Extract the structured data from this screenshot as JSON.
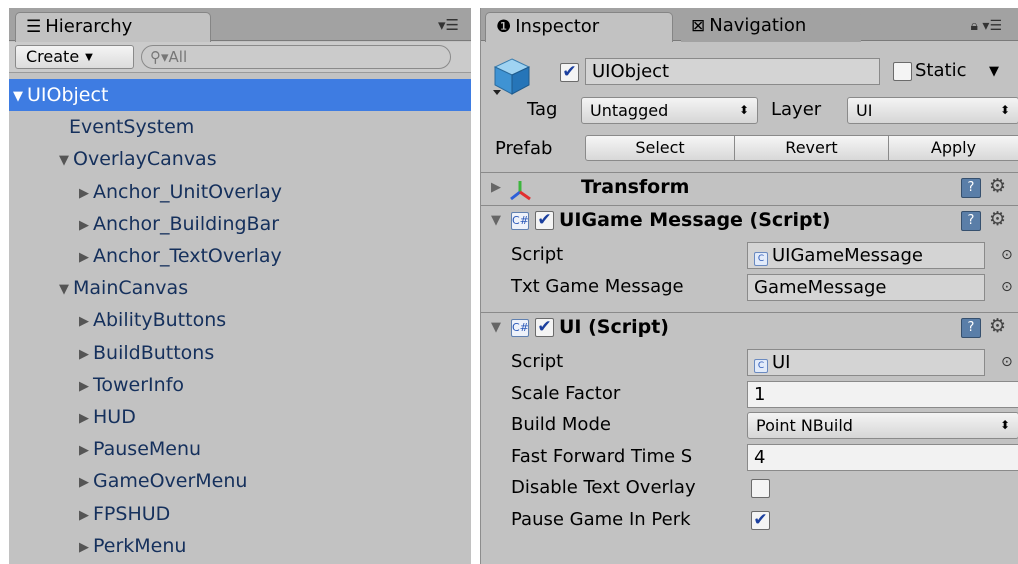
{
  "hierarchy": {
    "tab_label": "Hierarchy",
    "create_label": "Create",
    "search_placeholder": "All",
    "items": [
      {
        "label": "UIObject",
        "depth": 0,
        "arrow": "down",
        "selected": true
      },
      {
        "label": "EventSystem",
        "depth": 1,
        "arrow": "none",
        "selected": false
      },
      {
        "label": "OverlayCanvas",
        "depth": 1,
        "arrow": "down",
        "selected": false
      },
      {
        "label": "Anchor_UnitOverlay",
        "depth": 2,
        "arrow": "right",
        "selected": false
      },
      {
        "label": "Anchor_BuildingBar",
        "depth": 2,
        "arrow": "right",
        "selected": false
      },
      {
        "label": "Anchor_TextOverlay",
        "depth": 2,
        "arrow": "right",
        "selected": false
      },
      {
        "label": "MainCanvas",
        "depth": 1,
        "arrow": "down",
        "selected": false
      },
      {
        "label": "AbilityButtons",
        "depth": 2,
        "arrow": "right",
        "selected": false
      },
      {
        "label": "BuildButtons",
        "depth": 2,
        "arrow": "right",
        "selected": false
      },
      {
        "label": "TowerInfo",
        "depth": 2,
        "arrow": "right",
        "selected": false
      },
      {
        "label": "HUD",
        "depth": 2,
        "arrow": "right",
        "selected": false
      },
      {
        "label": "PauseMenu",
        "depth": 2,
        "arrow": "right",
        "selected": false
      },
      {
        "label": "GameOverMenu",
        "depth": 2,
        "arrow": "right",
        "selected": false
      },
      {
        "label": "FPSHUD",
        "depth": 2,
        "arrow": "right",
        "selected": false
      },
      {
        "label": "PerkMenu",
        "depth": 2,
        "arrow": "right",
        "selected": false
      }
    ]
  },
  "inspector": {
    "tab_label": "Inspector",
    "nav_tab_label": "Navigation",
    "object_name": "UIObject",
    "active": true,
    "static_label": "Static",
    "static_checked": false,
    "tag_label": "Tag",
    "tag_value": "Untagged",
    "layer_label": "Layer",
    "layer_value": "UI",
    "prefab_label": "Prefab",
    "prefab_select": "Select",
    "prefab_revert": "Revert",
    "prefab_apply": "Apply",
    "transform_title": "Transform",
    "components": [
      {
        "title": "UIGame Message (Script)",
        "enabled": true,
        "props": [
          {
            "label": "Script",
            "value": "UIGameMessage",
            "kind": "script"
          },
          {
            "label": "Txt Game Message",
            "value": "GameMessage",
            "kind": "object"
          }
        ]
      },
      {
        "title": "UI (Script)",
        "enabled": true,
        "props": [
          {
            "label": "Script",
            "value": "UI",
            "kind": "script"
          },
          {
            "label": "Scale Factor",
            "value": "1",
            "kind": "text"
          },
          {
            "label": "Build Mode",
            "value": "Point NBuild",
            "kind": "popup"
          },
          {
            "label": "Fast Forward Time S",
            "value": "4",
            "kind": "text"
          },
          {
            "label": "Disable Text Overlay",
            "checked": false,
            "kind": "toggle"
          },
          {
            "label": "Pause Game In Perk",
            "checked": true,
            "kind": "toggle"
          }
        ]
      }
    ]
  },
  "colors": {
    "selection": "#3e7ce2",
    "panel_bg": "#c2c2c2",
    "tab_bar": "#a2a2a2",
    "tree_text": "#15305c"
  },
  "icons": {
    "hierarchy_tab": "list-icon",
    "inspector_tab": "info-icon",
    "navigation_tab": "navmesh-icon",
    "lock": "lock-icon",
    "panel_menu": "menu-icon",
    "search": "search-icon",
    "gameobject": "cube-icon",
    "transform": "transform-axes-icon",
    "script": "script-icon",
    "help": "help-book-icon",
    "settings": "gear-icon",
    "object_picker": "target-circle-icon"
  }
}
